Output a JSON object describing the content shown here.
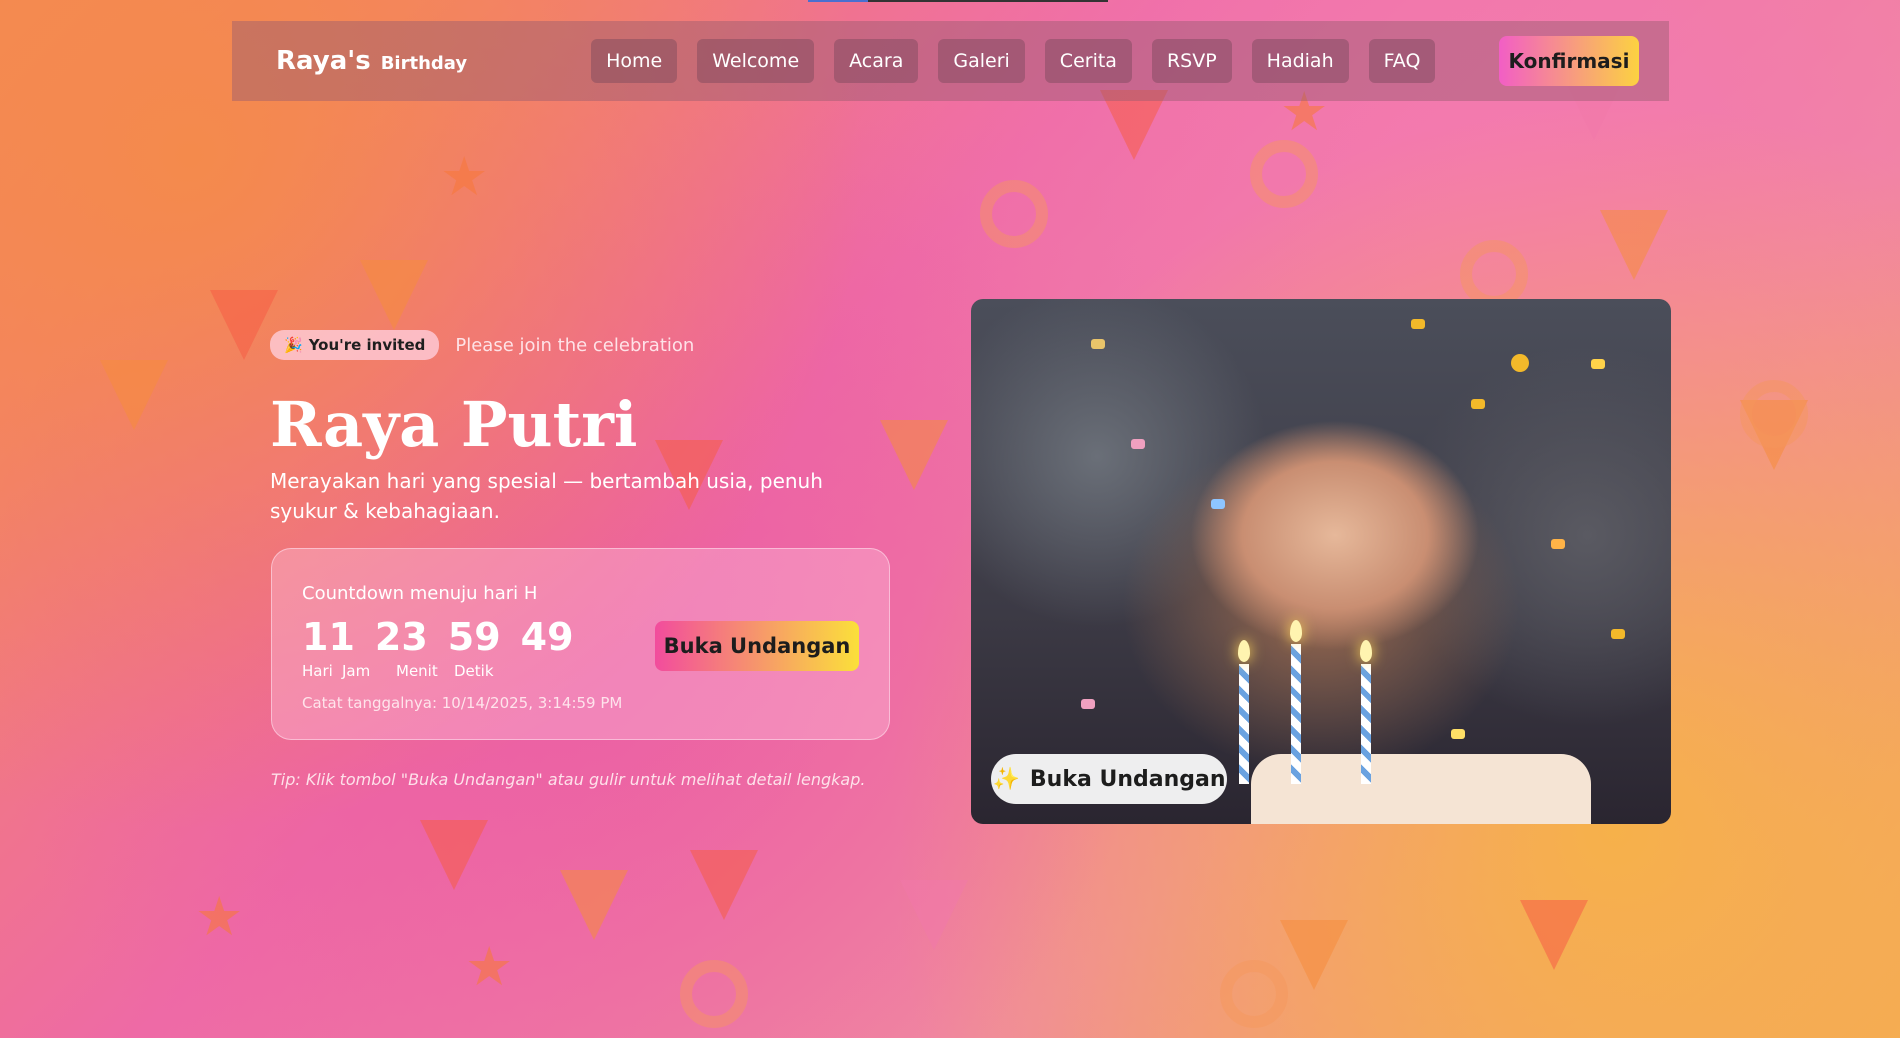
{
  "brand": {
    "name": "Raya's",
    "sub": "Birthday"
  },
  "nav": [
    "Home",
    "Welcome",
    "Acara",
    "Galeri",
    "Cerita",
    "RSVP",
    "Hadiah",
    "FAQ"
  ],
  "confirm_label": "Konfirmasi",
  "hero": {
    "invite_pill": "You're invited",
    "invite_note": "Please join the celebration",
    "name": "Raya Putri",
    "description": "Merayakan hari yang spesial — bertambah usia, penuh syukur & kebahagiaan."
  },
  "countdown": {
    "label": "Countdown menuju hari H",
    "values": {
      "days": "11",
      "hours": "23",
      "minutes": "59",
      "seconds": "49"
    },
    "units": {
      "days": "Hari",
      "hours": "Jam",
      "minutes": "Menit",
      "seconds": "Detik"
    },
    "note": "Catat tanggalnya: 10/14/2025, 3:14:59 PM",
    "button_label": "Buka Undangan"
  },
  "tip": "Tip: Klik tombol \"Buka Undangan\" atau gulir untuk melihat detail lengkap.",
  "photo": {
    "button_label": "Buka Undangan",
    "button_icon": "sparkle-icon"
  }
}
